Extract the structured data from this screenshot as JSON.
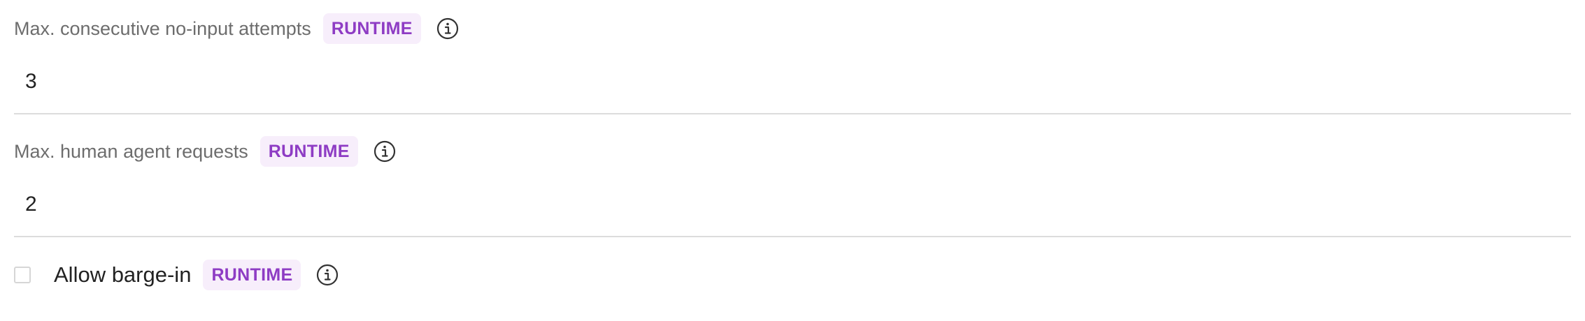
{
  "fields": [
    {
      "label": "Max. consecutive no-input attempts",
      "badge": "RUNTIME",
      "value": "3",
      "info_icon": "info-icon"
    },
    {
      "label": "Max. human agent requests",
      "badge": "RUNTIME",
      "value": "2",
      "info_icon": "info-icon"
    }
  ],
  "barge_in": {
    "label": "Allow barge-in",
    "badge": "RUNTIME",
    "checked": false,
    "info_icon": "info-icon"
  },
  "colors": {
    "badge_text": "#8e3cc4",
    "badge_background": "#f7eefb",
    "label_text": "#6d6d6d",
    "divider": "#dcdcdc"
  }
}
